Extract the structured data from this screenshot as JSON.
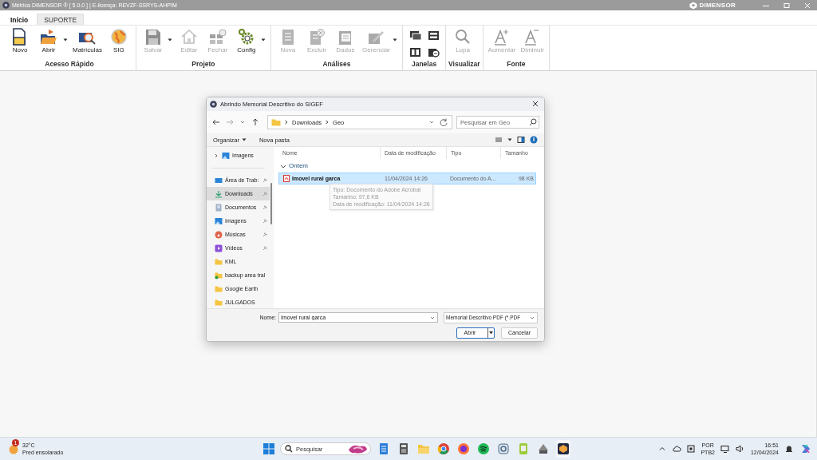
{
  "window": {
    "title": "Métrica DIMENSOR ® [ 5.0.0 ] | E-licença: REVZF-SSRYS-AHPIM",
    "brand": "DIMENSOR"
  },
  "tabs": [
    {
      "label": "Início",
      "selected": true
    },
    {
      "label": "SUPORTE",
      "selected": false
    }
  ],
  "ribbon": {
    "groups": [
      {
        "label": "Acesso Rápido",
        "buttons": [
          {
            "kind": "large",
            "label": "Novo",
            "disabled": false,
            "dropdown": false
          },
          {
            "kind": "large",
            "label": "Abrir",
            "disabled": false,
            "dropdown": true
          },
          {
            "kind": "large",
            "label": "Matrículas",
            "disabled": false,
            "dropdown": false
          },
          {
            "kind": "large",
            "label": "SIG",
            "disabled": false,
            "dropdown": false
          }
        ]
      },
      {
        "label": "Projeto",
        "buttons": [
          {
            "kind": "large",
            "label": "Salvar",
            "disabled": true,
            "dropdown": true
          },
          {
            "kind": "large",
            "label": "Editar",
            "disabled": true,
            "dropdown": false
          },
          {
            "kind": "large",
            "label": "Fechar",
            "disabled": true,
            "dropdown": false
          },
          {
            "kind": "large",
            "label": "Config",
            "disabled": false,
            "dropdown": true
          }
        ]
      },
      {
        "label": "Análises",
        "buttons": [
          {
            "kind": "large",
            "label": "Nova",
            "disabled": true,
            "dropdown": false
          },
          {
            "kind": "large",
            "label": "Excluir",
            "disabled": true,
            "dropdown": false
          },
          {
            "kind": "large",
            "label": "Dados",
            "disabled": true,
            "dropdown": false
          },
          {
            "kind": "large",
            "label": "Gerenciar",
            "disabled": true,
            "dropdown": true
          }
        ]
      },
      {
        "label": "Janelas",
        "buttons": [
          {
            "kind": "small",
            "disabled": false
          },
          {
            "kind": "small",
            "disabled": false
          },
          {
            "kind": "small",
            "disabled": false
          },
          {
            "kind": "small",
            "disabled": false
          }
        ]
      },
      {
        "label": "Visualizar",
        "buttons": [
          {
            "kind": "large",
            "label": "Lupa",
            "disabled": true,
            "dropdown": false
          }
        ]
      },
      {
        "label": "Fonte",
        "buttons": [
          {
            "kind": "large",
            "label": "Aumentar",
            "disabled": true,
            "dropdown": false
          },
          {
            "kind": "large",
            "label": "Diminuir",
            "disabled": true,
            "dropdown": false
          }
        ]
      }
    ]
  },
  "dialog": {
    "title": "Abrindo Memorial Descritivo do SIGEF",
    "path": [
      "Downloads",
      "Geo"
    ],
    "search": {
      "placeholder": "Pesquisar em Geo"
    },
    "toolbar": [
      {
        "label": "Organizar",
        "dropdown": true
      },
      {
        "label": "Nova pasta",
        "dropdown": false
      }
    ],
    "sidebar": {
      "top_item": {
        "label": "Imagens",
        "expanded": false
      },
      "items": [
        {
          "kind": "desktop",
          "label": "Área de Trab:",
          "pinned": true,
          "selected": false
        },
        {
          "kind": "downloads",
          "label": "Downloads",
          "pinned": true,
          "selected": true
        },
        {
          "kind": "documents",
          "label": "Documentos",
          "pinned": true,
          "selected": false
        },
        {
          "kind": "pictures",
          "label": "Imagens",
          "pinned": true,
          "selected": false
        },
        {
          "kind": "music",
          "label": "Músicas",
          "pinned": true,
          "selected": false
        },
        {
          "kind": "videos",
          "label": "Vídeos",
          "pinned": true,
          "selected": false
        },
        {
          "kind": "folder",
          "label": "KML",
          "pinned": false,
          "selected": false
        },
        {
          "kind": "folder-sync",
          "label": "backup area tral",
          "pinned": false,
          "selected": false
        },
        {
          "kind": "folder",
          "label": "Google Earth",
          "pinned": false,
          "selected": false
        },
        {
          "kind": "folder",
          "label": "JULGADOS",
          "pinned": false,
          "selected": false
        }
      ]
    },
    "columns": [
      "Nome",
      "Data de modificação",
      "Tipo",
      "Tamanho"
    ],
    "groups": [
      {
        "label": "Ontem",
        "expanded": true,
        "rows": [
          {
            "name": "Imovel rural garca",
            "date": "11/04/2024 14:26",
            "type": "Documento do A...",
            "size": "98 KB",
            "selected": true
          }
        ]
      }
    ],
    "tooltip": [
      "Tipo: Documento do Adobe Acrobat",
      "Tamanho: 97,6 KB",
      "Data de modificação: 11/04/2024 14:26"
    ],
    "filename_label": "Nome:",
    "filename": "Imovel rural garca",
    "filter": "Memorial Descritivo PDF (*.PDF",
    "buttons": [
      {
        "label": "Abrir",
        "kind": "split"
      },
      {
        "label": "Cancelar",
        "kind": "plain"
      }
    ]
  },
  "taskbar": {
    "weather": {
      "temperature": "32°C",
      "condition": "Pred ensolarado",
      "badge": "1"
    },
    "search": {
      "placeholder": "Pesquisar"
    },
    "language": [
      "POR",
      "PTB2"
    ],
    "time": "16:51",
    "date": "12/04/2024"
  }
}
